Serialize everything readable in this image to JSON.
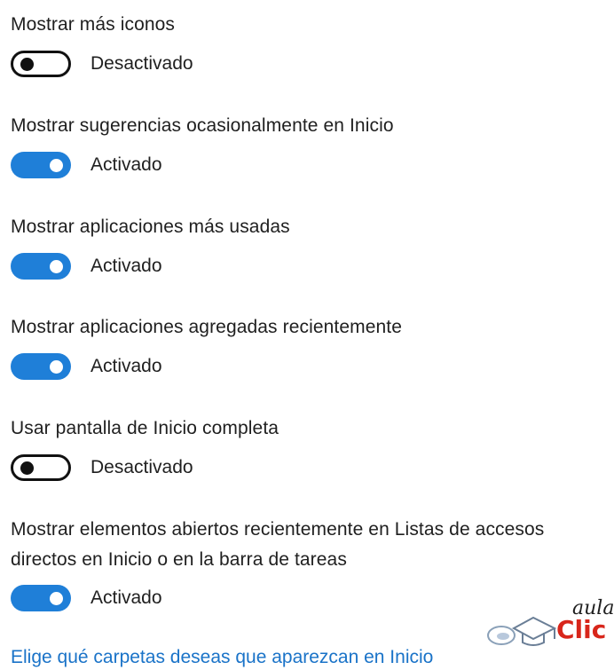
{
  "settings": [
    {
      "label": "Mostrar más iconos",
      "state": "Desactivado",
      "on": false
    },
    {
      "label": "Mostrar sugerencias ocasionalmente en Inicio",
      "state": "Activado",
      "on": true
    },
    {
      "label": "Mostrar aplicaciones más usadas",
      "state": "Activado",
      "on": true
    },
    {
      "label": "Mostrar aplicaciones agregadas recientemente",
      "state": "Activado",
      "on": true
    },
    {
      "label": "Usar pantalla de Inicio completa",
      "state": "Desactivado",
      "on": false
    },
    {
      "label": "Mostrar elementos abiertos recientemente en Listas de accesos directos en Inicio o en la barra de tareas",
      "state": "Activado",
      "on": true
    }
  ],
  "link": {
    "text": "Elige qué carpetas deseas que aparezcan en Inicio"
  },
  "logo": {
    "word_top": "aula",
    "word_bottom": "Clic"
  },
  "colors": {
    "accent": "#1f7fd8",
    "link": "#1a73c8",
    "logo_red": "#d8261b"
  }
}
